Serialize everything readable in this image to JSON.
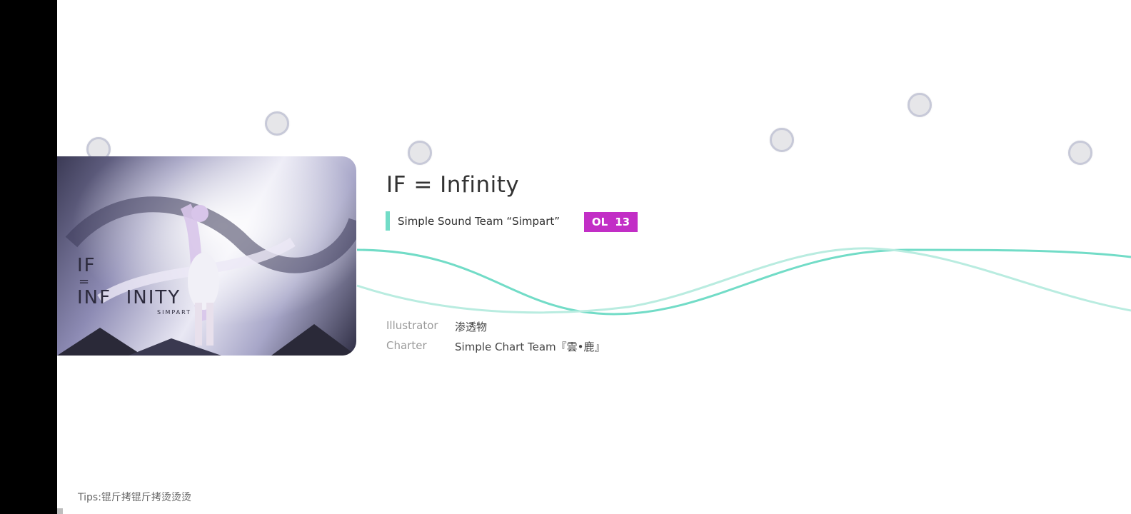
{
  "song": {
    "title": "IF = Infinity",
    "artist": "Simple Sound Team “Simpart”",
    "level_label": "OL",
    "level_value": "13",
    "level_color": "#c22ec6",
    "artist_accent_color": "#72dcc7"
  },
  "cover": {
    "title_line1": "IF",
    "title_line2": "=",
    "title_line3": "INF  INITY",
    "brand": "SIMPART"
  },
  "credits": {
    "illustrator_label": "Illustrator",
    "illustrator_value": "渗透物",
    "charter_label": "Charter",
    "charter_value": "Simple Chart Team『雲•鹿』"
  },
  "tips": "Tips:锟斤拷锟斤拷烫烫烫",
  "theme": {
    "wave_color": "#72dcc7",
    "bubble_fill": "#e6e6e9",
    "bubble_border": "#c7c9d8"
  }
}
